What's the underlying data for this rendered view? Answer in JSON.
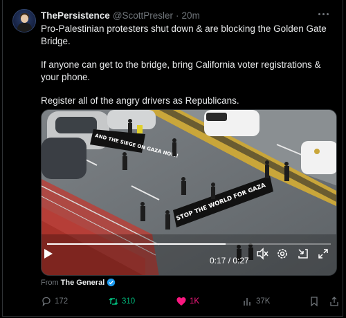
{
  "post": {
    "display_name": "ThePersistence",
    "handle": "@ScottPresler",
    "separator": "·",
    "time": "20m",
    "paragraphs": [
      "Pro-Palestinian protesters shut down & are blocking the Golden Gate Bridge.",
      "If anyone can get to the bridge, bring California voter registrations & your phone.",
      "Register all of the angry drivers as Republicans."
    ]
  },
  "video": {
    "timestamp": "0:17 / 0:27",
    "progress": 0.63,
    "banner_left": "AND THE SIEGE ON GAZA NOW!",
    "banner_right": "STOP THE WORLD FOR GAZA"
  },
  "source": {
    "prefix": "From",
    "name": "The General"
  },
  "actions": {
    "replies": "172",
    "reposts": "310",
    "likes": "1K",
    "views": "37K"
  },
  "colors": {
    "repost": "#00ba7c",
    "like": "#f91880",
    "verified": "#1d9bf0",
    "muted": "#71767b"
  }
}
